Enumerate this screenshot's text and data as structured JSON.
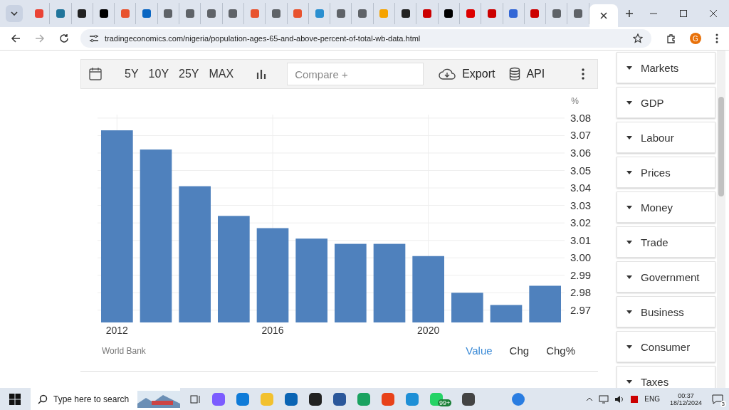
{
  "browser": {
    "tabs": [
      {
        "selected": false
      },
      {
        "selected": false
      },
      {
        "selected": false
      },
      {
        "selected": false
      },
      {
        "selected": false
      },
      {
        "selected": false
      },
      {
        "selected": false
      },
      {
        "selected": false
      },
      {
        "selected": false
      },
      {
        "selected": false
      },
      {
        "selected": false
      },
      {
        "selected": false
      },
      {
        "selected": false
      },
      {
        "selected": false
      },
      {
        "selected": false
      },
      {
        "selected": false
      },
      {
        "selected": false
      },
      {
        "selected": false
      },
      {
        "selected": false
      },
      {
        "selected": false
      },
      {
        "selected": false
      },
      {
        "selected": false
      },
      {
        "selected": false
      },
      {
        "selected": false
      },
      {
        "selected": false
      },
      {
        "selected": false
      },
      {
        "selected": true
      }
    ],
    "url": "tradingeconomics.com/nigeria/population-ages-65-and-above-percent-of-total-wb-data.html",
    "profile_initial": "G"
  },
  "toolbar": {
    "ranges": [
      "5Y",
      "10Y",
      "25Y",
      "MAX"
    ],
    "compare_placeholder": "Compare +",
    "export": "Export",
    "api": "API"
  },
  "chart_data": {
    "type": "bar",
    "ylabel": "%",
    "x": [
      2012,
      2013,
      2014,
      2015,
      2016,
      2017,
      2018,
      2019,
      2020,
      2021,
      2022,
      2023
    ],
    "series": [
      {
        "color": "#4f81bd",
        "values": [
          3.073,
          3.062,
          3.041,
          3.024,
          3.017,
          3.011,
          3.008,
          3.008,
          3.001,
          2.98,
          2.973,
          2.984
        ]
      }
    ],
    "xlim": [
      2011.5,
      2023.5
    ],
    "ylim": [
      2.963,
      3.082
    ],
    "yticks": [
      {
        "value": 2.97,
        "label": "2.97"
      },
      {
        "value": 2.98,
        "label": "2.98"
      },
      {
        "value": 2.99,
        "label": "2.99"
      },
      {
        "value": 3.0,
        "label": "3.00"
      },
      {
        "value": 3.01,
        "label": "3.01"
      },
      {
        "value": 3.02,
        "label": "3.02"
      },
      {
        "value": 3.03,
        "label": "3.03"
      },
      {
        "value": 3.04,
        "label": "3.04"
      },
      {
        "value": 3.05,
        "label": "3.05"
      },
      {
        "value": 3.06,
        "label": "3.06"
      },
      {
        "value": 3.07,
        "label": "3.07"
      },
      {
        "value": 3.08,
        "label": "3.08"
      }
    ],
    "xticks": [
      2012,
      2016,
      2020
    ],
    "grid": true
  },
  "source": "World Bank",
  "views": [
    {
      "label": "Value",
      "selected": true
    },
    {
      "label": "Chg",
      "selected": false
    },
    {
      "label": "Chg%",
      "selected": false
    }
  ],
  "sidebar": {
    "items": [
      "Markets",
      "GDP",
      "Labour",
      "Prices",
      "Money",
      "Trade",
      "Government",
      "Business",
      "Consumer",
      "Taxes"
    ]
  },
  "taskbar": {
    "search_placeholder": "Type here to search",
    "mail_badge": "99+",
    "language": "ENG",
    "time": "00:37",
    "date": "18/12/2024",
    "notifications": "3"
  }
}
